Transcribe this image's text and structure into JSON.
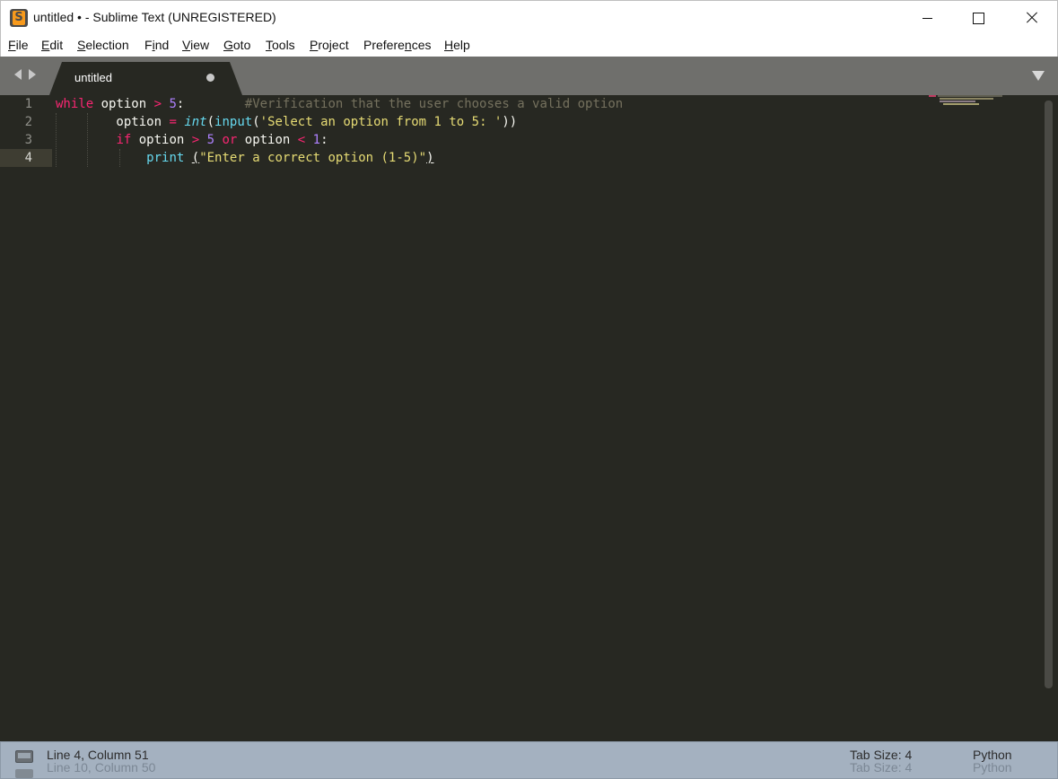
{
  "window": {
    "title": "untitled • - Sublime Text (UNREGISTERED)",
    "app_icon_letter": "S",
    "icons": {
      "app": "sublime-text-icon",
      "minimize": "minimize-icon",
      "maximize": "maximize-icon",
      "close": "close-icon"
    }
  },
  "menu": {
    "items": [
      {
        "label": "File",
        "accel": "F",
        "rest": "ile"
      },
      {
        "label": "Edit",
        "accel": "E",
        "rest": "dit"
      },
      {
        "label": "Selection",
        "accel": "S",
        "rest": "election"
      },
      {
        "label": "Find",
        "pre": "F",
        "accel": "i",
        "rest": "nd"
      },
      {
        "label": "View",
        "accel": "V",
        "rest": "iew"
      },
      {
        "label": "Goto",
        "accel": "G",
        "rest": "oto"
      },
      {
        "label": "Tools",
        "accel": "T",
        "rest": "ools"
      },
      {
        "label": "Project",
        "accel": "P",
        "rest": "roject"
      },
      {
        "label": "Preferences",
        "pre": "Prefere",
        "accel": "n",
        "rest": "ces"
      },
      {
        "label": "Help",
        "accel": "H",
        "rest": "elp"
      }
    ]
  },
  "tabs": [
    {
      "label": "untitled",
      "dirty": true,
      "active": true
    }
  ],
  "editor": {
    "theme_colors": {
      "background": "#272822",
      "keyword": "#f92672",
      "number": "#ae81ff",
      "string": "#e6db74",
      "comment": "#75715e",
      "builtin": "#66d9ef",
      "text": "#f8f8f2"
    },
    "line_numbers": [
      "1",
      "2",
      "3",
      "4"
    ],
    "active_line": 4,
    "lines": [
      [
        {
          "t": "while",
          "c": "kw"
        },
        {
          "t": " option "
        },
        {
          "t": ">",
          "c": "op"
        },
        {
          "t": " "
        },
        {
          "t": "5",
          "c": "num"
        },
        {
          "t": ":        "
        },
        {
          "t": "#Verification that the user chooses a valid option",
          "c": "cm"
        }
      ],
      [
        {
          "t": "        option "
        },
        {
          "t": "=",
          "c": "op"
        },
        {
          "t": " "
        },
        {
          "t": "int",
          "c": "bi-it"
        },
        {
          "t": "("
        },
        {
          "t": "input",
          "c": "bi"
        },
        {
          "t": "("
        },
        {
          "t": "'Select an option from 1 to 5: '",
          "c": "str"
        },
        {
          "t": "))"
        }
      ],
      [
        {
          "t": "        "
        },
        {
          "t": "if",
          "c": "kw"
        },
        {
          "t": " option "
        },
        {
          "t": ">",
          "c": "op"
        },
        {
          "t": " "
        },
        {
          "t": "5",
          "c": "num"
        },
        {
          "t": " "
        },
        {
          "t": "or",
          "c": "kw"
        },
        {
          "t": " option "
        },
        {
          "t": "<",
          "c": "op"
        },
        {
          "t": " "
        },
        {
          "t": "1",
          "c": "num"
        },
        {
          "t": ":"
        }
      ],
      [
        {
          "t": "            "
        },
        {
          "t": "print",
          "c": "bi"
        },
        {
          "t": " "
        },
        {
          "t": "(",
          "c": "paren-ul"
        },
        {
          "t": "\"Enter a correct option (1-5)\"",
          "c": "str"
        },
        {
          "t": ")",
          "c": "paren-ul"
        }
      ]
    ]
  },
  "status": {
    "position": "Line 4, Column 51",
    "position_ghost": "Line 10, Column 50",
    "tab_size": "Tab Size: 4",
    "tab_size_ghost": "Tab Size: 4",
    "syntax": "Python",
    "syntax_ghost": "Python",
    "icons": {
      "panel": "panel-toggle-icon"
    }
  }
}
